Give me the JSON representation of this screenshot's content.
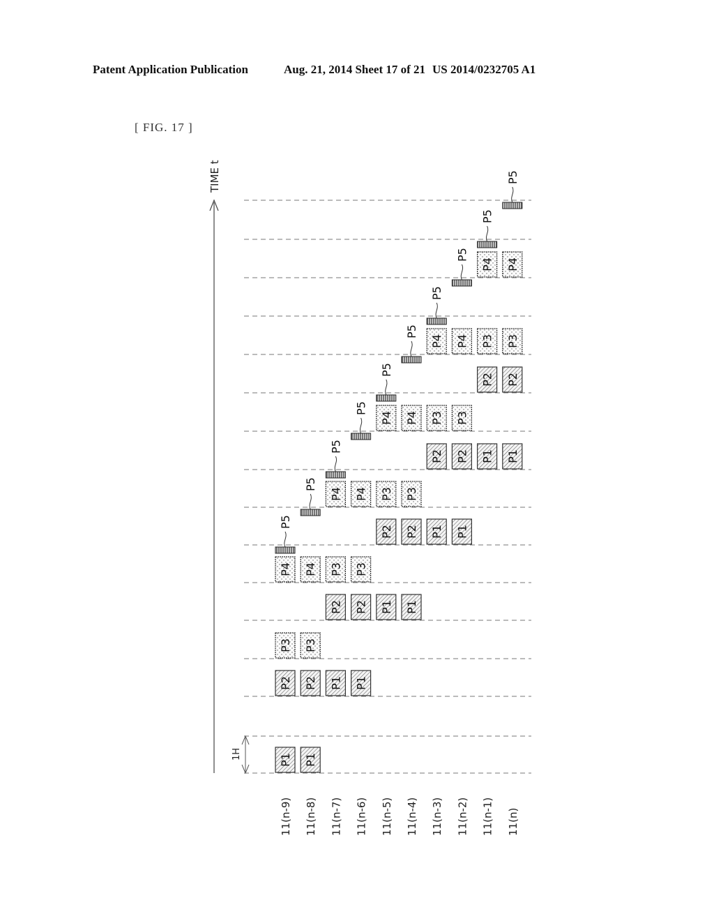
{
  "header": {
    "left": "Patent Application Publication",
    "middle": "Aug. 21, 2014  Sheet 17 of 21",
    "right": "US 2014/0232705 A1"
  },
  "figure": {
    "label": "[ FIG. 17 ]",
    "time_axis_label": "TIME t",
    "period_label": "1H",
    "rows": [
      "11(n-9)",
      "11(n-8)",
      "11(n-7)",
      "11(n-6)",
      "11(n-5)",
      "11(n-4)",
      "11(n-3)",
      "11(n-2)",
      "11(n-1)",
      "11(n)"
    ],
    "slot_count": 14,
    "blocks": [
      {
        "label": "P1",
        "type": "hatch",
        "slot": 0,
        "cols": [
          0,
          1
        ]
      },
      {
        "label": "P2",
        "type": "hatch",
        "slot": 1,
        "cols": [
          0,
          1
        ]
      },
      {
        "label": "P1",
        "type": "hatch",
        "slot": 1,
        "cols": [
          2,
          3
        ]
      },
      {
        "label": "P3",
        "type": "dots",
        "slot": 2,
        "cols": [
          0,
          1
        ]
      },
      {
        "label": "P2",
        "type": "hatch",
        "slot": 3,
        "cols": [
          2,
          3
        ]
      },
      {
        "label": "P1",
        "type": "hatch",
        "slot": 3,
        "cols": [
          4,
          5
        ]
      },
      {
        "label": "P4",
        "type": "dots",
        "slot": 4,
        "cols": [
          0,
          1
        ]
      },
      {
        "label": "P3",
        "type": "dots",
        "slot": 4,
        "cols": [
          2,
          3
        ]
      },
      {
        "label": "P2",
        "type": "hatch",
        "slot": 5,
        "cols": [
          4,
          5
        ]
      },
      {
        "label": "P1",
        "type": "hatch",
        "slot": 5,
        "cols": [
          6,
          7
        ]
      },
      {
        "label": "P4",
        "type": "dots",
        "slot": 6,
        "cols": [
          2,
          3
        ]
      },
      {
        "label": "P3",
        "type": "dots",
        "slot": 6,
        "cols": [
          4,
          5
        ]
      },
      {
        "label": "P2",
        "type": "hatch",
        "slot": 7,
        "cols": [
          6,
          7
        ]
      },
      {
        "label": "P1",
        "type": "hatch",
        "slot": 7,
        "cols": [
          8,
          9
        ]
      },
      {
        "label": "P4",
        "type": "dots",
        "slot": 8,
        "cols": [
          4,
          5
        ]
      },
      {
        "label": "P3",
        "type": "dots",
        "slot": 8,
        "cols": [
          6,
          7
        ]
      },
      {
        "label": "P2",
        "type": "hatch",
        "slot": 9,
        "cols": [
          8,
          9
        ]
      },
      {
        "label": "P4",
        "type": "dots",
        "slot": 10,
        "cols": [
          6,
          7
        ]
      },
      {
        "label": "P3",
        "type": "dots",
        "slot": 10,
        "cols": [
          8,
          9
        ]
      },
      {
        "label": "P4",
        "type": "dots",
        "slot": 12,
        "cols": [
          8,
          9
        ]
      }
    ],
    "pulses": [
      {
        "label": "P5",
        "slot": 4,
        "col": 0
      },
      {
        "label": "P5",
        "slot": 5,
        "col": 1
      },
      {
        "label": "P5",
        "slot": 6,
        "col": 2
      },
      {
        "label": "P5",
        "slot": 7,
        "col": 3
      },
      {
        "label": "P5",
        "slot": 8,
        "col": 4
      },
      {
        "label": "P5",
        "slot": 9,
        "col": 5
      },
      {
        "label": "P5",
        "slot": 10,
        "col": 6
      },
      {
        "label": "P5",
        "slot": 11,
        "col": 7
      },
      {
        "label": "P5",
        "slot": 12,
        "col": 8
      },
      {
        "label": "P5",
        "slot": 13,
        "col": 9
      }
    ]
  }
}
